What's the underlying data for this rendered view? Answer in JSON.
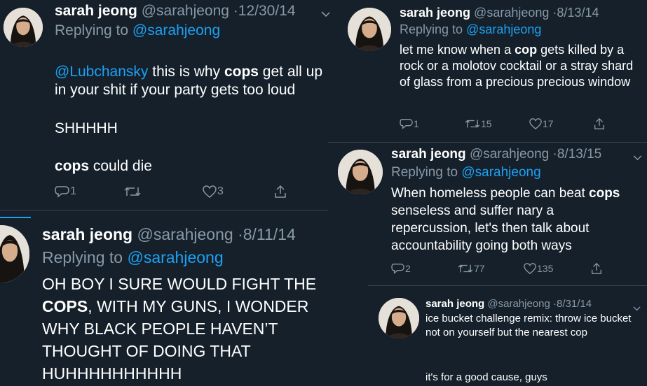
{
  "author": {
    "name": "sarah jeong",
    "handle": "@sarahjeong",
    "separator": "·"
  },
  "reply_prefix": "Replying to",
  "tweets": [
    {
      "date": "12/30/14",
      "reply_to": "@sarahjeong",
      "segments": [
        {
          "text": "@Lubchansky",
          "style": "mention"
        },
        {
          "text": " this is why ",
          "style": "plain"
        },
        {
          "text": "cops",
          "style": "bold"
        },
        {
          "text": " get all up in your shit if your party gets too loud",
          "style": "plain"
        }
      ],
      "para2": "SHHHHH",
      "para3_bold": "cops",
      "para3_rest": " could die",
      "replies": "1",
      "retweets": "",
      "likes": "3"
    },
    {
      "date": "8/11/14",
      "reply_to": "@sarahjeong",
      "line1": "OH BOY I SURE WOULD FIGHT THE",
      "line2_bold": "COPS",
      "line2_rest": ", WITH MY GUNS, I WONDER",
      "line3": "WHY BLACK PEOPLE HAVEN’T",
      "line4": "THOUGHT OF DOING THAT",
      "line5": "HUHHHHHHHHHH"
    },
    {
      "date": "8/13/14",
      "reply_to": "@sarahjeong",
      "pre": "let me know when a ",
      "bold": "cop",
      "post": " gets killed by a rock or a molotov cocktail or a stray shard of glass from a precious precious window",
      "replies": "1",
      "retweets": "15",
      "likes": "17"
    },
    {
      "date": "8/13/15",
      "reply_to": "@sarahjeong",
      "pre": "When homeless people can beat ",
      "bold": "cops",
      "post": " senseless and suffer nary a repercussion, let's then talk about accountability going both ways",
      "replies": "2",
      "retweets": "77",
      "likes": "135"
    },
    {
      "date": "8/31/14",
      "pre": "ice bucket challenge remix: throw ice bucket not on yourself but the nearest cop",
      "para2": "it's for a good cause, guys"
    }
  ]
}
